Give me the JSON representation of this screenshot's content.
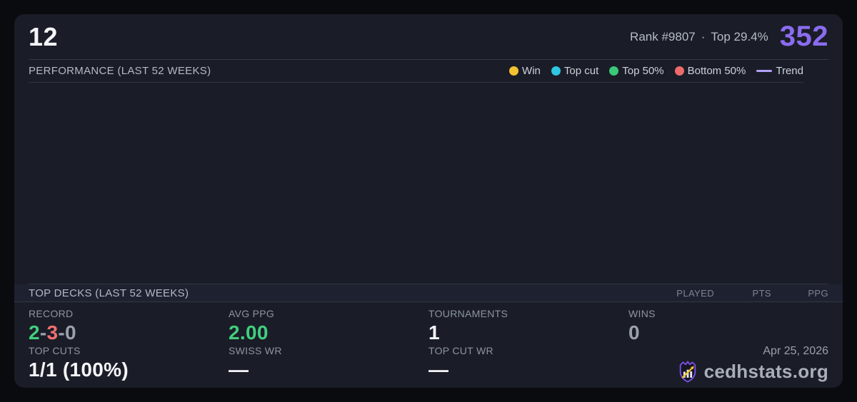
{
  "colors": {
    "accent": "#8b6cf0",
    "positive": "#41ce7e",
    "negative": "#f07070",
    "neutral": "#9aa1ad",
    "legend_win": "#f2c230",
    "legend_top_cut": "#2ec6e0",
    "legend_top50": "#3bc878",
    "legend_bottom50": "#ef6b6b",
    "legend_trend": "#b3a0f8"
  },
  "header": {
    "deck_count": "12",
    "rank": "Rank #9807",
    "dot": "·",
    "top_percent": "Top 29.4%",
    "score": "352"
  },
  "performance": {
    "title": "PERFORMANCE (LAST 52 WEEKS)",
    "legend": [
      {
        "label": "Win"
      },
      {
        "label": "Top cut"
      },
      {
        "label": "Top 50%"
      },
      {
        "label": "Bottom 50%"
      },
      {
        "label": "Trend"
      }
    ],
    "chart_points": []
  },
  "top_decks": {
    "title": "TOP DECKS (LAST 52 WEEKS)",
    "columns": [
      "PLAYED",
      "PTS",
      "PPG"
    ],
    "rows": []
  },
  "stats": {
    "record": {
      "label": "RECORD",
      "wins": "2",
      "losses": "3",
      "draws": "0",
      "sep": "-"
    },
    "avg_ppg": {
      "label": "AVG PPG",
      "value": "2.00"
    },
    "tournaments": {
      "label": "TOURNAMENTS",
      "value": "1"
    },
    "wins": {
      "label": "WINS",
      "value": "0"
    },
    "top_cuts": {
      "label": "TOP CUTS",
      "value": "1/1 (100%)"
    },
    "swiss_wr": {
      "label": "SWISS WR",
      "value": "—"
    },
    "top_cut_wr": {
      "label": "TOP CUT WR",
      "value": "—"
    }
  },
  "footer": {
    "date": "Apr 25, 2026",
    "brand": "cedhstats.org"
  }
}
